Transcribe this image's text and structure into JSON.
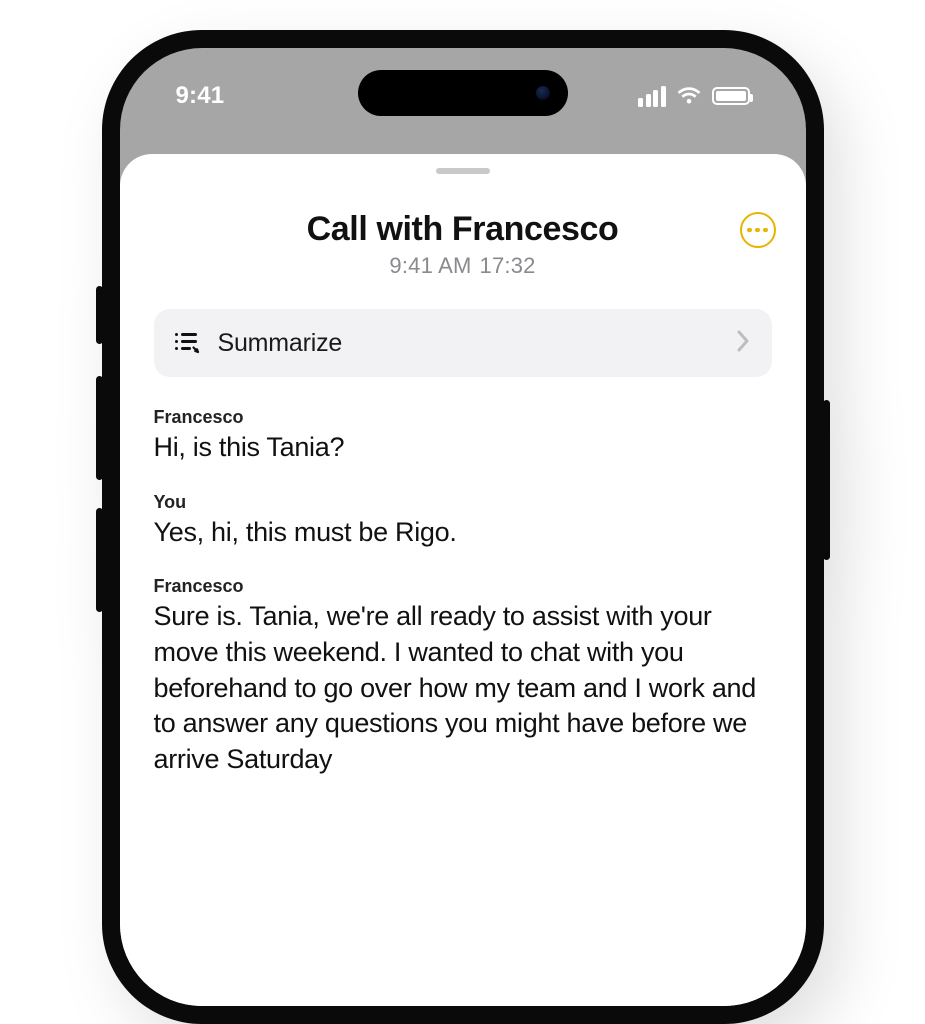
{
  "status": {
    "time": "9:41"
  },
  "header": {
    "title": "Call with Francesco",
    "time": "9:41 AM",
    "duration": "17:32"
  },
  "summarize": {
    "label": "Summarize"
  },
  "transcript": [
    {
      "speaker": "Francesco",
      "text": "Hi, is this Tania?"
    },
    {
      "speaker": "You",
      "text": "Yes, hi, this must be Rigo."
    },
    {
      "speaker": "Francesco",
      "text": "Sure is. Tania, we're all ready to assist with your move this weekend. I wanted to chat with you beforehand to go over how my team and I work and to answer any questions you might have before we arrive Saturday"
    }
  ]
}
